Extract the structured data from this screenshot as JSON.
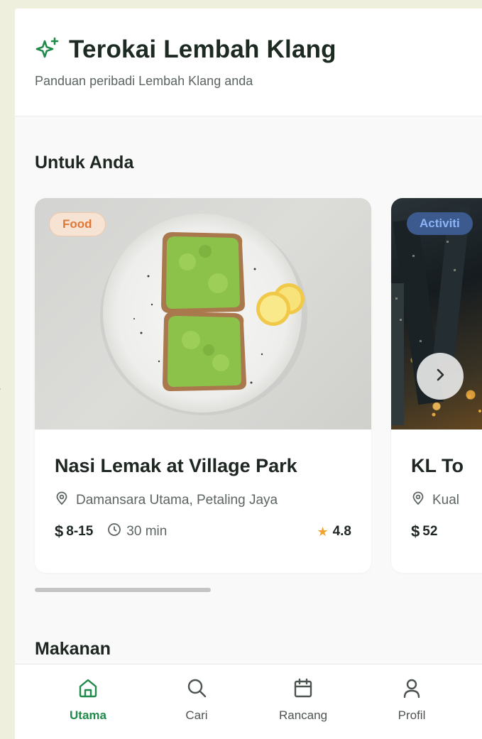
{
  "header": {
    "title": "Terokai Lembah Klang",
    "subtitle": "Panduan peribadi Lembah Klang anda"
  },
  "sections": {
    "for_you": "Untuk Anda",
    "food": "Makanan"
  },
  "cards": [
    {
      "tag": "Food",
      "title": "Nasi Lemak at Village Park",
      "location": "Damansara Utama, Petaling Jaya",
      "price": "8-15",
      "time": "30 min",
      "rating": "4.8"
    },
    {
      "tag": "Activiti",
      "title": "KL To",
      "location": "Kual",
      "price": "52"
    }
  ],
  "nav": {
    "items": [
      {
        "label": "Utama",
        "icon": "home-icon",
        "active": true
      },
      {
        "label": "Cari",
        "icon": "search-icon",
        "active": false
      },
      {
        "label": "Rancang",
        "icon": "calendar-icon",
        "active": false
      },
      {
        "label": "Profil",
        "icon": "user-icon",
        "active": false
      }
    ]
  },
  "colors": {
    "accent": "#1f8a4a",
    "food_tag": "#e07835",
    "star": "#f1a32d"
  }
}
